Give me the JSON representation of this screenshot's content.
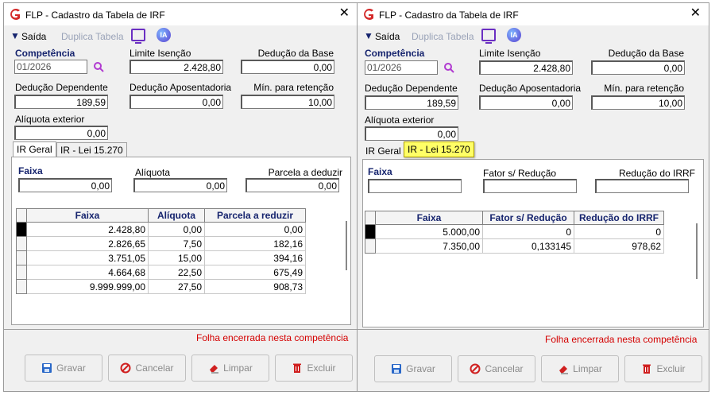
{
  "windows": [
    {
      "title": "FLP - Cadastro da Tabela de IRF",
      "toolbar": {
        "saida": "Saída",
        "duplica": "Duplica Tabela",
        "ia": "IA"
      },
      "fields": {
        "competencia_label": "Competência",
        "competencia_value": "01/2026",
        "limite_label": "Limite Isenção",
        "limite_value": "2.428,80",
        "deducao_base_label": "Dedução da Base",
        "deducao_base_value": "0,00",
        "deducao_dep_label": "Dedução Dependente",
        "deducao_dep_value": "189,59",
        "deducao_apos_label": "Dedução Aposentadoria",
        "deducao_apos_value": "0,00",
        "min_ret_label": "Mín. para retenção",
        "min_ret_value": "10,00",
        "aliquota_ext_label": "Alíquota exterior",
        "aliquota_ext_value": "0,00"
      },
      "tabs": [
        "IR Geral",
        "IR - Lei 15.270"
      ],
      "editor": {
        "labels": [
          "Faixa",
          "Alíquota",
          "Parcela a deduzir"
        ],
        "values": [
          "0,00",
          "0,00",
          "0,00"
        ]
      },
      "grid": {
        "columns": [
          "Faixa",
          "Alíquota",
          "Parcela a reduzir"
        ],
        "rows": [
          [
            "2.428,80",
            "0,00",
            "0,00"
          ],
          [
            "2.826,65",
            "7,50",
            "182,16"
          ],
          [
            "3.751,05",
            "15,00",
            "394,16"
          ],
          [
            "4.664,68",
            "22,50",
            "675,49"
          ],
          [
            "9.999.999,00",
            "27,50",
            "908,73"
          ]
        ]
      },
      "message": "Folha encerrada nesta competência",
      "buttons": {
        "gravar": "Gravar",
        "cancelar": "Cancelar",
        "limpar": "Limpar",
        "excluir": "Excluir"
      }
    },
    {
      "title": "FLP - Cadastro da Tabela de IRF",
      "toolbar": {
        "saida": "Saída",
        "duplica": "Duplica Tabela",
        "ia": "IA"
      },
      "fields": {
        "competencia_label": "Competência",
        "competencia_value": "01/2026",
        "limite_label": "Limite Isenção",
        "limite_value": "2.428,80",
        "deducao_base_label": "Dedução da Base",
        "deducao_base_value": "0,00",
        "deducao_dep_label": "Dedução Dependente",
        "deducao_dep_value": "189,59",
        "deducao_apos_label": "Dedução Aposentadoria",
        "deducao_apos_value": "0,00",
        "min_ret_label": "Mín. para retenção",
        "min_ret_value": "10,00",
        "aliquota_ext_label": "Alíquota exterior",
        "aliquota_ext_value": "0,00"
      },
      "tabs": [
        "IR Geral",
        "IR - Lei 15.270"
      ],
      "editor": {
        "labels": [
          "Faixa",
          "Fator s/ Redução",
          "Redução do IRRF"
        ],
        "values": [
          "",
          "",
          ""
        ]
      },
      "grid": {
        "columns": [
          "Faixa",
          "Fator s/ Redução",
          "Redução do IRRF"
        ],
        "rows": [
          [
            "5.000,00",
            "0",
            "0"
          ],
          [
            "7.350,00",
            "0,133145",
            "978,62"
          ]
        ]
      },
      "message": "Folha encerrada nesta competência",
      "buttons": {
        "gravar": "Gravar",
        "cancelar": "Cancelar",
        "limpar": "Limpar",
        "excluir": "Excluir"
      }
    }
  ],
  "colors": {
    "label_blue": "#16246e",
    "message_red": "#d40000",
    "tab_highlight": "#ffff66",
    "logo_red": "#d42a2a"
  }
}
